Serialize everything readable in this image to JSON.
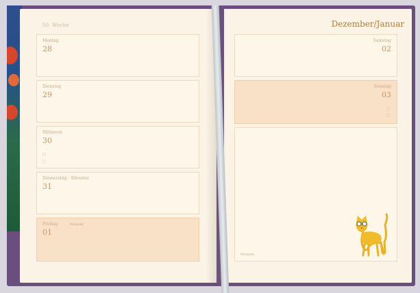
{
  "left_page": {
    "week_label": "50. Woche",
    "days": [
      {
        "name": "Montag",
        "num": "28"
      },
      {
        "name": "Dienstag",
        "num": "29"
      },
      {
        "name": "Mittwoch",
        "num": "30"
      },
      {
        "name": "Donnerstag · Silvester",
        "num": "31"
      },
      {
        "name": "Freitag",
        "extra": "Neujahr",
        "num": "01"
      }
    ]
  },
  "right_page": {
    "month_title": "Dezember/Januar",
    "days": [
      {
        "name": "Samstag",
        "num": "02"
      },
      {
        "name": "Sonntag",
        "num": "03"
      }
    ],
    "notes_label": "Notizen"
  },
  "colors": {
    "cover": "#6a4f7e",
    "page": "#fbf4e6",
    "shaded_box": "#f9e1c7",
    "accent_text": "#b57a38"
  },
  "icons": [
    "cat-illustration-icon",
    "bookmark-ribbon"
  ]
}
